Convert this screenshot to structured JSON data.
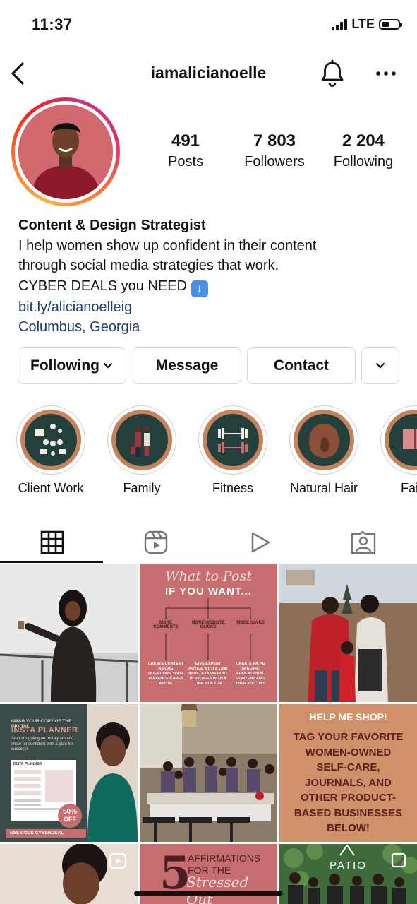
{
  "status_bar": {
    "time": "11:37",
    "network": "LTE"
  },
  "header": {
    "username": "iamalicianoelle"
  },
  "stats": [
    {
      "value": "491",
      "label": "Posts"
    },
    {
      "value": "7 803",
      "label": "Followers"
    },
    {
      "value": "2 204",
      "label": "Following"
    }
  ],
  "bio": {
    "title": "Content & Design Strategist",
    "line1": "I help women show up confident in their content",
    "line2": "through social media strategies that work.",
    "line3": "CYBER DEALS you NEED",
    "link": "bit.ly/alicianoelleig",
    "location": "Columbus, Georgia"
  },
  "actions": {
    "following": "Following",
    "message": "Message",
    "contact": "Contact"
  },
  "highlights": [
    {
      "label": "Client Work"
    },
    {
      "label": "Family"
    },
    {
      "label": "Fitness"
    },
    {
      "label": "Natural Hair"
    },
    {
      "label": "Fai"
    }
  ],
  "posts": {
    "p2": {
      "script_title": "What to Post",
      "title": "IF YOU WANT...",
      "col1_head": "MORE COMMENTS",
      "col2_head": "MORE WEBSITE CLICKS",
      "col3_head": "MORE SAVES",
      "col1_body": "CREATE CONTENT ASKING QUESTIONS YOUR AUDIENCE CARES ABOUT",
      "col2_body": "GIVE EXPERT ADVICE WITH A LINK IN BIO CTA OR POST IN STORIES WITH A LINK STICKER",
      "col3_body": "CREATE NICHE SPECIFIC EDUCATIONAL CONTENT AND THEN ADD THIS"
    },
    "p4": {
      "small": "GRAB YOUR COPY OF THE DIGITAL",
      "title": "INSTA PLANNER",
      "desc": "Stop struggling on Instagram and show up confident with a plan for success!",
      "doc_title": "INSTA PLANNER",
      "badge_pct": "50%",
      "badge_off": "OFF",
      "code": "USE CODE CYBERDEAL"
    },
    "p6": {
      "head": "HELP ME SHOP!",
      "body": "TAG YOUR FAVORITE WOMEN-OWNED SELF-CARE, JOURNALS, AND OTHER PRODUCT-BASED BUSINESSES BELOW!"
    },
    "p8": {
      "number": "5",
      "line1": "AFFIRMATIONS",
      "line2": "FOR THE",
      "script": "Stressed Out"
    },
    "p9": {
      "sign": "PATIO"
    }
  },
  "colors": {
    "accent_link": "#1f3b6f",
    "highlight_ring": "#c6825a",
    "highlight_dark": "#23403d",
    "pink_tile": "#c56d6f",
    "tan_tile": "#d0916a"
  }
}
